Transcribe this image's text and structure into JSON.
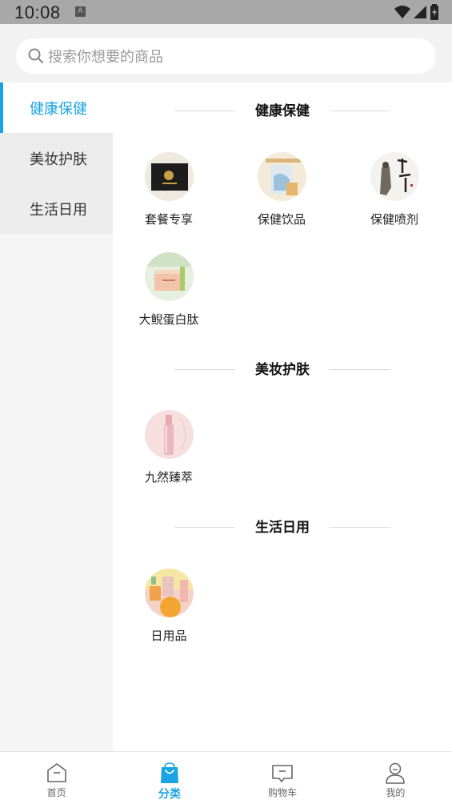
{
  "status_bar": {
    "time": "10:08",
    "notif_glyph": "A"
  },
  "search": {
    "placeholder": "搜索你想要的商品"
  },
  "sidebar": {
    "items": [
      {
        "label": "健康保健",
        "active": true
      },
      {
        "label": "美妆护肤",
        "active": false
      },
      {
        "label": "生活日用",
        "active": false
      }
    ]
  },
  "sections": [
    {
      "title": "健康保健",
      "items": [
        {
          "label": "套餐专享",
          "icon": "gift-box-photo"
        },
        {
          "label": "保健饮品",
          "icon": "drink-box-photo"
        },
        {
          "label": "保健喷剂",
          "icon": "calligraphy-photo"
        },
        {
          "label": "大鲵蛋白肽",
          "icon": "peptide-box-photo"
        }
      ]
    },
    {
      "title": "美妆护肤",
      "items": [
        {
          "label": "九然臻萃",
          "icon": "serum-bottle-photo"
        }
      ]
    },
    {
      "title": "生活日用",
      "items": [
        {
          "label": "日用品",
          "icon": "daily-goods-photo"
        }
      ]
    }
  ],
  "bottom_nav": {
    "items": [
      {
        "label": "首页",
        "icon": "home-icon",
        "active": false
      },
      {
        "label": "分类",
        "icon": "shopping-bag-icon",
        "active": true
      },
      {
        "label": "购物车",
        "icon": "cart-message-icon",
        "active": false
      },
      {
        "label": "我的",
        "icon": "user-icon",
        "active": false
      }
    ]
  },
  "colors": {
    "accent": "#1aa3e3",
    "sidebar_bg": "#ececec",
    "search_bg": "#f2f2f2"
  }
}
